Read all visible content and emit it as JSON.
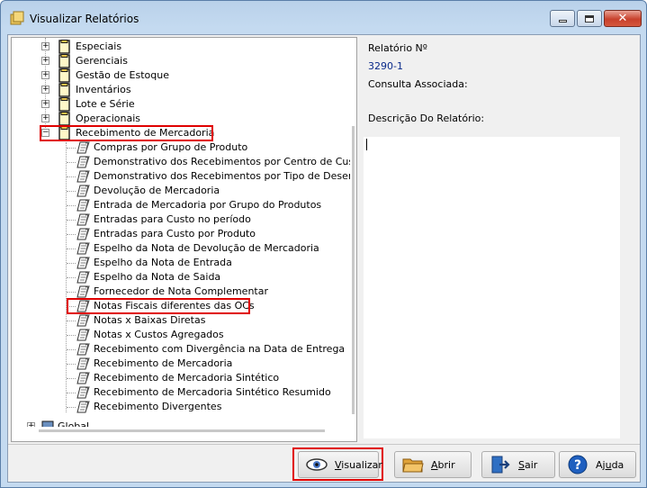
{
  "window": {
    "title": "Visualizar Relatórios"
  },
  "tree": {
    "top_folders": [
      {
        "label": "Especiais"
      },
      {
        "label": "Gerenciais"
      },
      {
        "label": "Gestão de Estoque"
      },
      {
        "label": "Inventários"
      },
      {
        "label": "Lote e Série"
      },
      {
        "label": "Operacionais"
      }
    ],
    "expanded_folder": {
      "label": "Recebimento de Mercadoria",
      "children": [
        "Compras por Grupo de Produto",
        "Demonstrativo dos Recebimentos por Centro de Custo",
        "Demonstrativo dos Recebimentos por Tipo de Desembolso",
        "Devolução de Mercadoria",
        "Entrada de Mercadoria por Grupo do Produtos",
        "Entradas para Custo no período",
        "Entradas para Custo por Produto",
        "Espelho da Nota de Devolução de Mercadoria",
        "Espelho da Nota de Entrada",
        "Espelho da Nota de Saida",
        "Fornecedor de Nota Complementar",
        "Notas Fiscais diferentes das OCs",
        "Notas x Baixas Diretas",
        "Notas x Custos Agregados",
        "Recebimento com Divergência na Data de Entrega",
        "Recebimento de Mercadoria",
        "Recebimento de Mercadoria Sintético",
        "Recebimento de Mercadoria Sintético Resumido",
        "Recebimento Divergentes"
      ]
    },
    "root_label": "Global",
    "selected_child": "Notas Fiscais diferentes das OCs"
  },
  "info": {
    "report_number_label": "Relatório Nº",
    "report_number_value": "3290-1",
    "query_label": "Consulta Associada:",
    "description_label": "Descrição Do Relatório:"
  },
  "buttons": {
    "view": {
      "pre": "",
      "ul": "V",
      "post": "isualizar"
    },
    "open": {
      "pre": "",
      "ul": "A",
      "post": "brir"
    },
    "exit": {
      "pre": "",
      "ul": "S",
      "post": "air"
    },
    "help": {
      "pre": "Aj",
      "ul": "u",
      "post": "da"
    }
  },
  "colors": {
    "highlight": "#e00000",
    "info_value": "#0a2a8a"
  }
}
